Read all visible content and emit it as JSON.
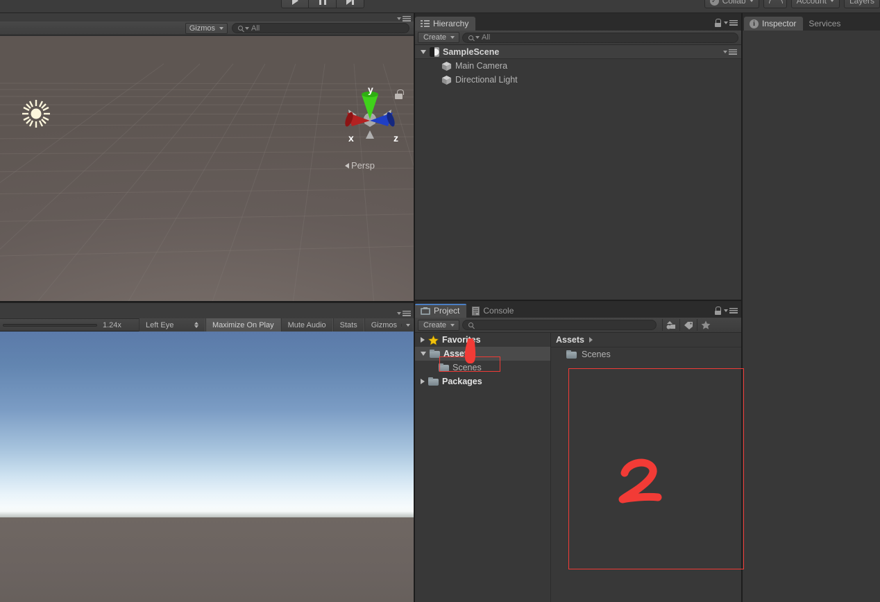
{
  "app_toolbar": {
    "play_icon": "play-icon",
    "pause_icon": "pause-icon",
    "step_icon": "step-icon",
    "collab_label": "Collab",
    "cloud_icon": "cloud-icon",
    "account_label": "Account",
    "layers_label": "Layers"
  },
  "scene_view": {
    "gizmos_label": "Gizmos",
    "search_placeholder": "All",
    "search_value": "",
    "persp_label": "Persp",
    "axis_x": "x",
    "axis_y": "y",
    "axis_z": "z",
    "light_gizmo": "directional-light-gizmo",
    "lock_icon": "lock-icon"
  },
  "game_view": {
    "zoom_label": "1.24x",
    "eye_label": "Left Eye",
    "maximize_label": "Maximize On Play",
    "mute_label": "Mute Audio",
    "stats_label": "Stats",
    "gizmos_label": "Gizmos"
  },
  "hierarchy": {
    "tab_label": "Hierarchy",
    "create_label": "Create",
    "search_placeholder": "All",
    "search_value": "",
    "scene_name": "SampleScene",
    "objects": [
      {
        "label": "Main Camera",
        "icon": "cube-icon"
      },
      {
        "label": "Directional Light",
        "icon": "cube-icon"
      }
    ]
  },
  "inspector": {
    "tab_label": "Inspector",
    "services_tab_label": "Services",
    "info_icon": "info-icon"
  },
  "project": {
    "tab_label": "Project",
    "console_tab_label": "Console",
    "create_label": "Create",
    "search_placeholder": "",
    "search_value": "",
    "toolbar_icons": [
      "object-filter-icon",
      "label-tag-icon",
      "favorite-star-icon"
    ],
    "tree": [
      {
        "label": "Favorites",
        "icon": "star-icon",
        "expanded": false,
        "depth": 0,
        "selected": false
      },
      {
        "label": "Assets",
        "icon": "folder-icon",
        "expanded": true,
        "depth": 0,
        "selected": true
      },
      {
        "label": "Scenes",
        "icon": "folder-icon",
        "expanded": null,
        "depth": 1,
        "selected": false
      },
      {
        "label": "Packages",
        "icon": "folder-icon",
        "expanded": false,
        "depth": 0,
        "selected": false
      }
    ],
    "breadcrumb": "Assets",
    "grid_items": [
      {
        "label": "Scenes",
        "icon": "folder-icon"
      }
    ]
  },
  "annotations": {
    "accent_color": "#f23b36",
    "number_label": "2",
    "highlighted_target": "Assets",
    "stroke": "pointer-stroke",
    "region_box": "content-area-box"
  },
  "colors": {
    "panel_bg": "#383838",
    "tab_bg": "#2b2b2b",
    "toolbar_bg": "#3c3c3c",
    "selection": "#4a4a4a",
    "tab_active_accent": "#4b7fc4",
    "scene_bg": "#6b625f",
    "sky_top": "#5b7aa9",
    "ground": "#6f6762"
  }
}
